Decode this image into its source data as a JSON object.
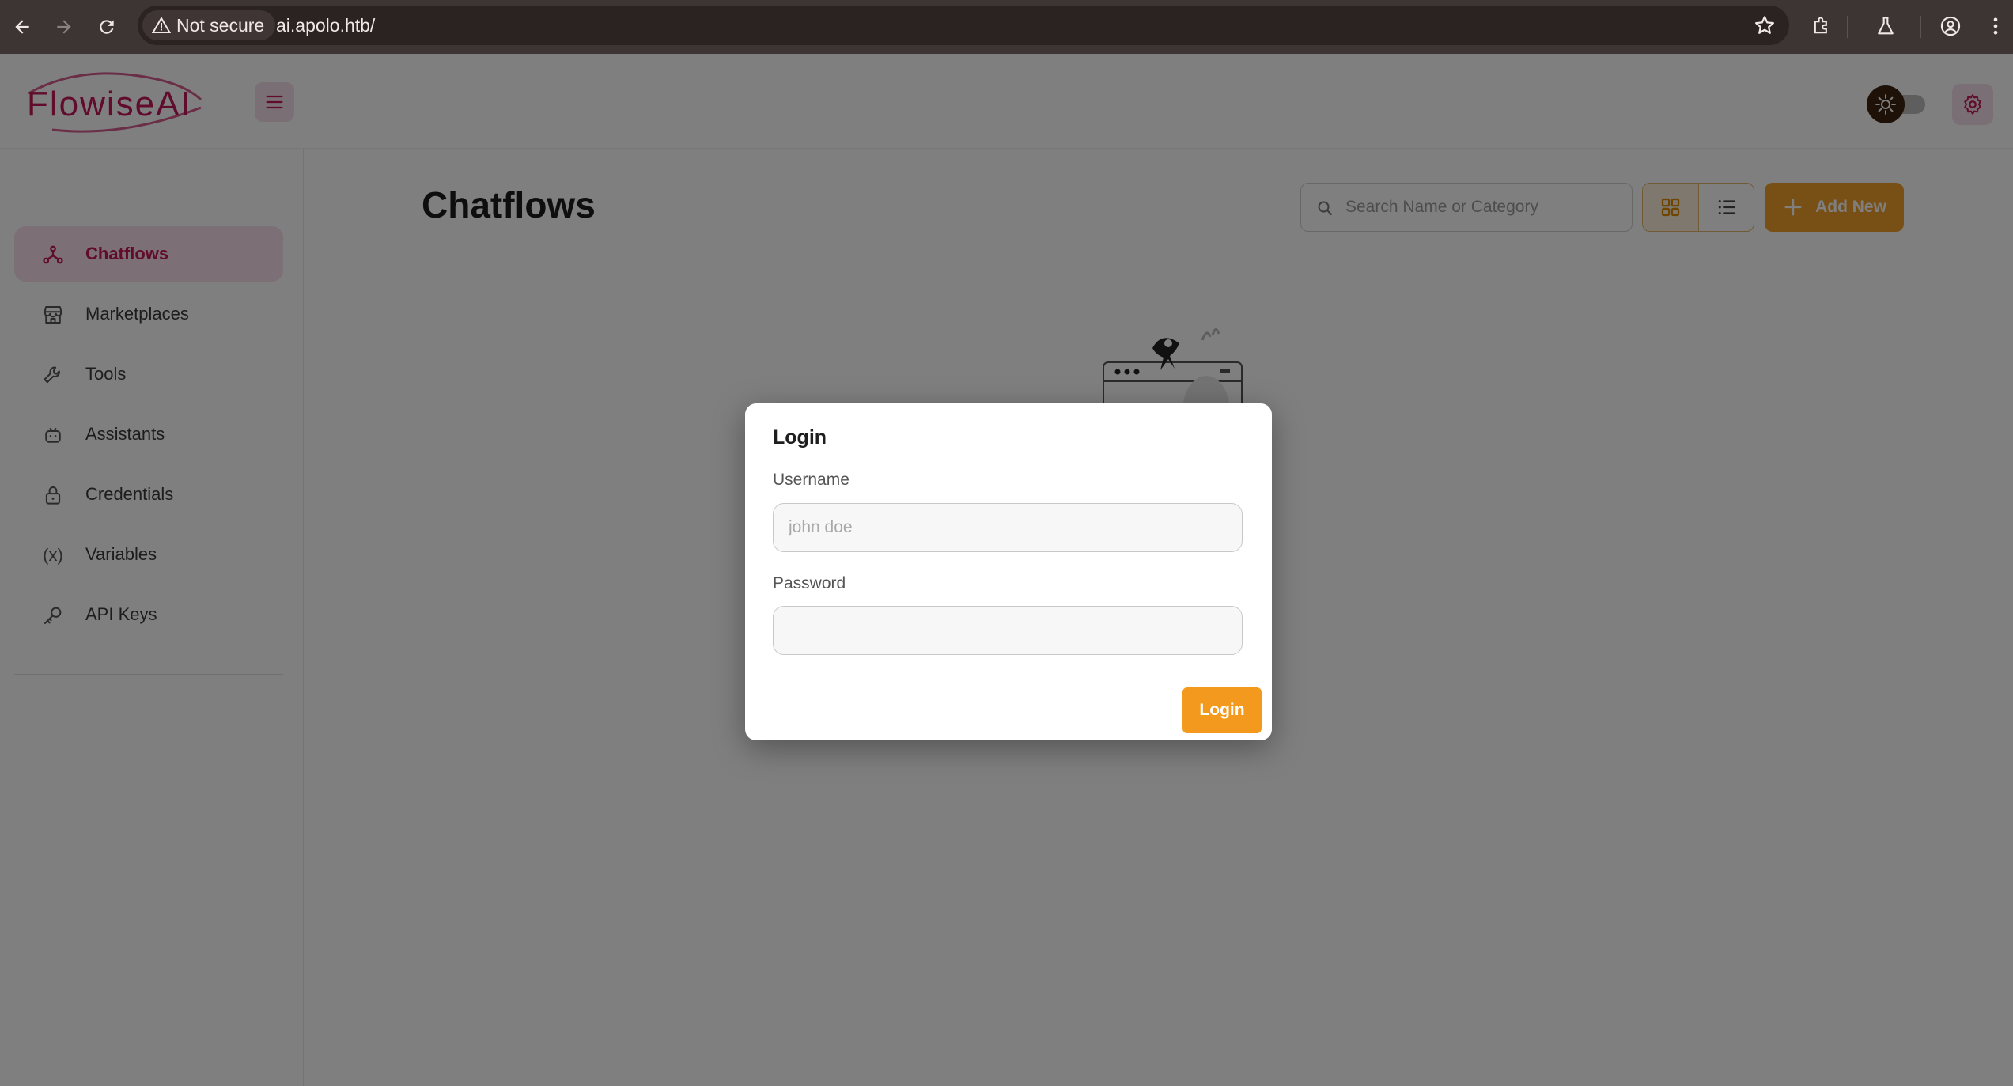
{
  "browser": {
    "security_label": "Not secure",
    "url": "ai.apolo.htb/"
  },
  "app": {
    "logo_text": "FlowiseAI",
    "brand_color": "#c2185b",
    "accent_color": "#f0a12a"
  },
  "sidebar": {
    "items": [
      {
        "label": "Chatflows",
        "icon": "chatflows-icon",
        "active": true
      },
      {
        "label": "Marketplaces",
        "icon": "marketplace-icon"
      },
      {
        "label": "Tools",
        "icon": "tools-icon"
      },
      {
        "label": "Assistants",
        "icon": "robot-icon"
      },
      {
        "label": "Credentials",
        "icon": "lock-icon"
      },
      {
        "label": "Variables",
        "icon": "variable-icon",
        "icon_text": "(x)"
      },
      {
        "label": "API Keys",
        "icon": "key-icon"
      }
    ]
  },
  "main": {
    "title": "Chatflows",
    "search_placeholder": "Search Name or Category",
    "add_new_label": "Add New",
    "view_mode": "card"
  },
  "modal": {
    "title": "Login",
    "username_label": "Username",
    "username_placeholder": "john doe",
    "username_value": "",
    "password_label": "Password",
    "password_value": "",
    "submit_label": "Login"
  }
}
